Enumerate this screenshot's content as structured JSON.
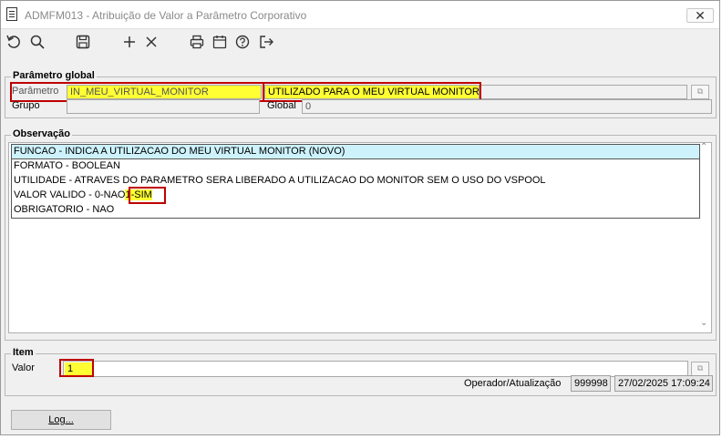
{
  "window": {
    "title": "ADMFM013 - Atribuição de Valor a Parâmetro Corporativo",
    "close_symbol": "✕"
  },
  "toolbar": {
    "icons": [
      "refresh-icon",
      "search-icon",
      "save-icon",
      "add-icon",
      "delete-icon",
      "print-icon",
      "calendar-icon",
      "help-icon",
      "exit-icon"
    ]
  },
  "parametro_global": {
    "title": "Parâmetro global",
    "parametro_label": "Parâmetro",
    "parametro_value": "IN_MEU_VIRTUAL_MONITOR",
    "descricao_value": "UTILIZADO PARA O MEU VIRTUAL MONITOR",
    "grupo_label": "Grupo",
    "grupo_value": "",
    "global_label": "Global",
    "global_value": "0"
  },
  "observacao": {
    "title": "Observação",
    "lines": [
      "FUNCAO - INDICA A UTILIZACAO DO MEU VIRTUAL MONITOR (NOVO)",
      "FORMATO -  BOOLEAN",
      "UTILIDADE - ATRAVES DO PARAMETRO SERA LIBERADO A UTILIZACAO DO MONITOR SEM O USO DO VSPOOL",
      "VALOR VALIDO -     0-NAO",
      "OBRIGATORIO - NAO"
    ],
    "valor_valido_sim": "1-SIM"
  },
  "item": {
    "title": "Item",
    "valor_label": "Valor",
    "valor_value": "1",
    "operador_label": "Operador/Atualização",
    "operador_value": "999998",
    "atualizacao_value": "27/02/2025 17:09:24"
  },
  "footer": {
    "log_button": "Log..."
  },
  "colors": {
    "highlight": "#ffff33",
    "annotation_box": "#c00000",
    "selected_row": "#cdf2fb"
  }
}
